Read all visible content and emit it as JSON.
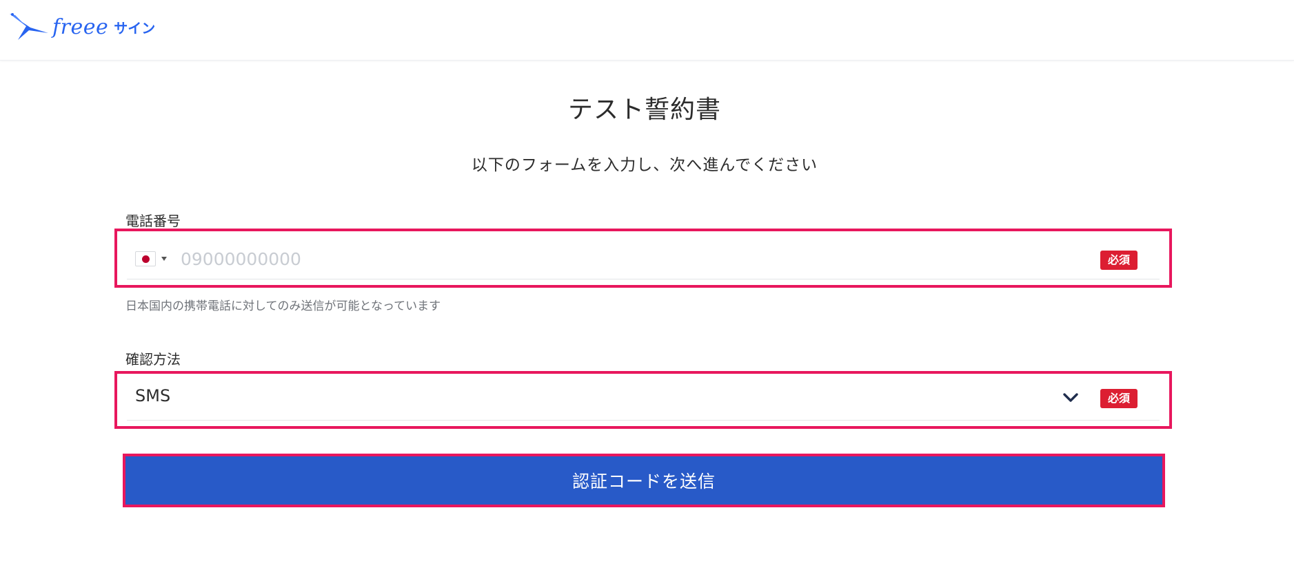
{
  "header": {
    "logo_text": "freee",
    "logo_sub": "サイン"
  },
  "page": {
    "title": "テスト誓約書",
    "subtitle": "以下のフォームを入力し、次へ進んでください"
  },
  "phone_field": {
    "label": "電話番号",
    "country_flag": "japan-flag",
    "value": "",
    "placeholder": "09000000000",
    "required_badge": "必須",
    "helper_text": "日本国内の携帯電話に対してのみ送信が可能となっています"
  },
  "method_field": {
    "label": "確認方法",
    "selected_value": "SMS",
    "required_badge": "必須"
  },
  "submit": {
    "label": "認証コードを送信"
  },
  "colors": {
    "brand": "#2864f0",
    "primary_button": "#285ac8",
    "required_badge": "#dc1e32",
    "highlight_border": "#e8175d"
  }
}
